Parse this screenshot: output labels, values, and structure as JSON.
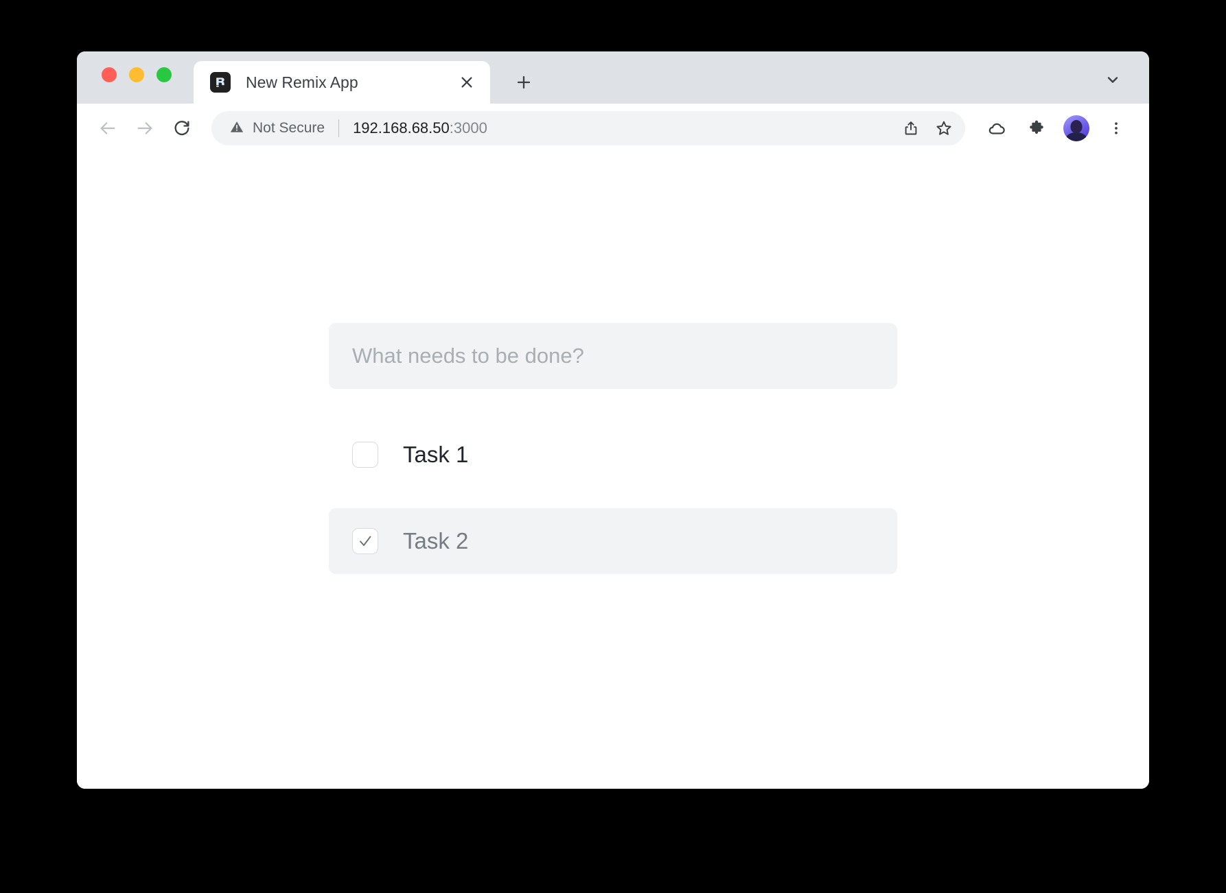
{
  "window": {
    "traffic_lights": [
      {
        "name": "close",
        "color": "#ff5f57"
      },
      {
        "name": "minimize",
        "color": "#febc2e"
      },
      {
        "name": "maximize",
        "color": "#28c840"
      }
    ]
  },
  "tab_strip": {
    "active_tab": {
      "title": "New Remix App",
      "favicon": "remix-logo-icon",
      "close_icon": "close-icon"
    },
    "new_tab_icon": "plus-icon",
    "tab_list_icon": "chevron-down-icon"
  },
  "toolbar": {
    "back_icon": "arrow-left-icon",
    "forward_icon": "arrow-right-icon",
    "reload_icon": "reload-icon",
    "omnibox": {
      "security_icon": "warning-triangle-icon",
      "security_label": "Not Secure",
      "url_host": "192.168.68.50",
      "url_port": ":3000",
      "url_full": "192.168.68.50:3000",
      "share_icon": "share-icon",
      "bookmark_icon": "star-icon"
    },
    "cloud_icon": "cloud-icon",
    "extensions_icon": "puzzle-piece-icon",
    "profile_icon": "avatar",
    "menu_icon": "three-dots-vertical-icon"
  },
  "page": {
    "todo_input": {
      "placeholder": "What needs to be done?",
      "value": ""
    },
    "todos": [
      {
        "label": "Task 1",
        "done": false,
        "check_glyph": ""
      },
      {
        "label": "Task 2",
        "done": true,
        "check_glyph": "✓"
      }
    ]
  },
  "colors": {
    "desktop_background": "#000000",
    "tab_strip": "#dee1e6",
    "omnibox": "#f1f3f4",
    "todo_row_done": "#f2f3f5",
    "accent_profile": "#6c5ce7"
  }
}
